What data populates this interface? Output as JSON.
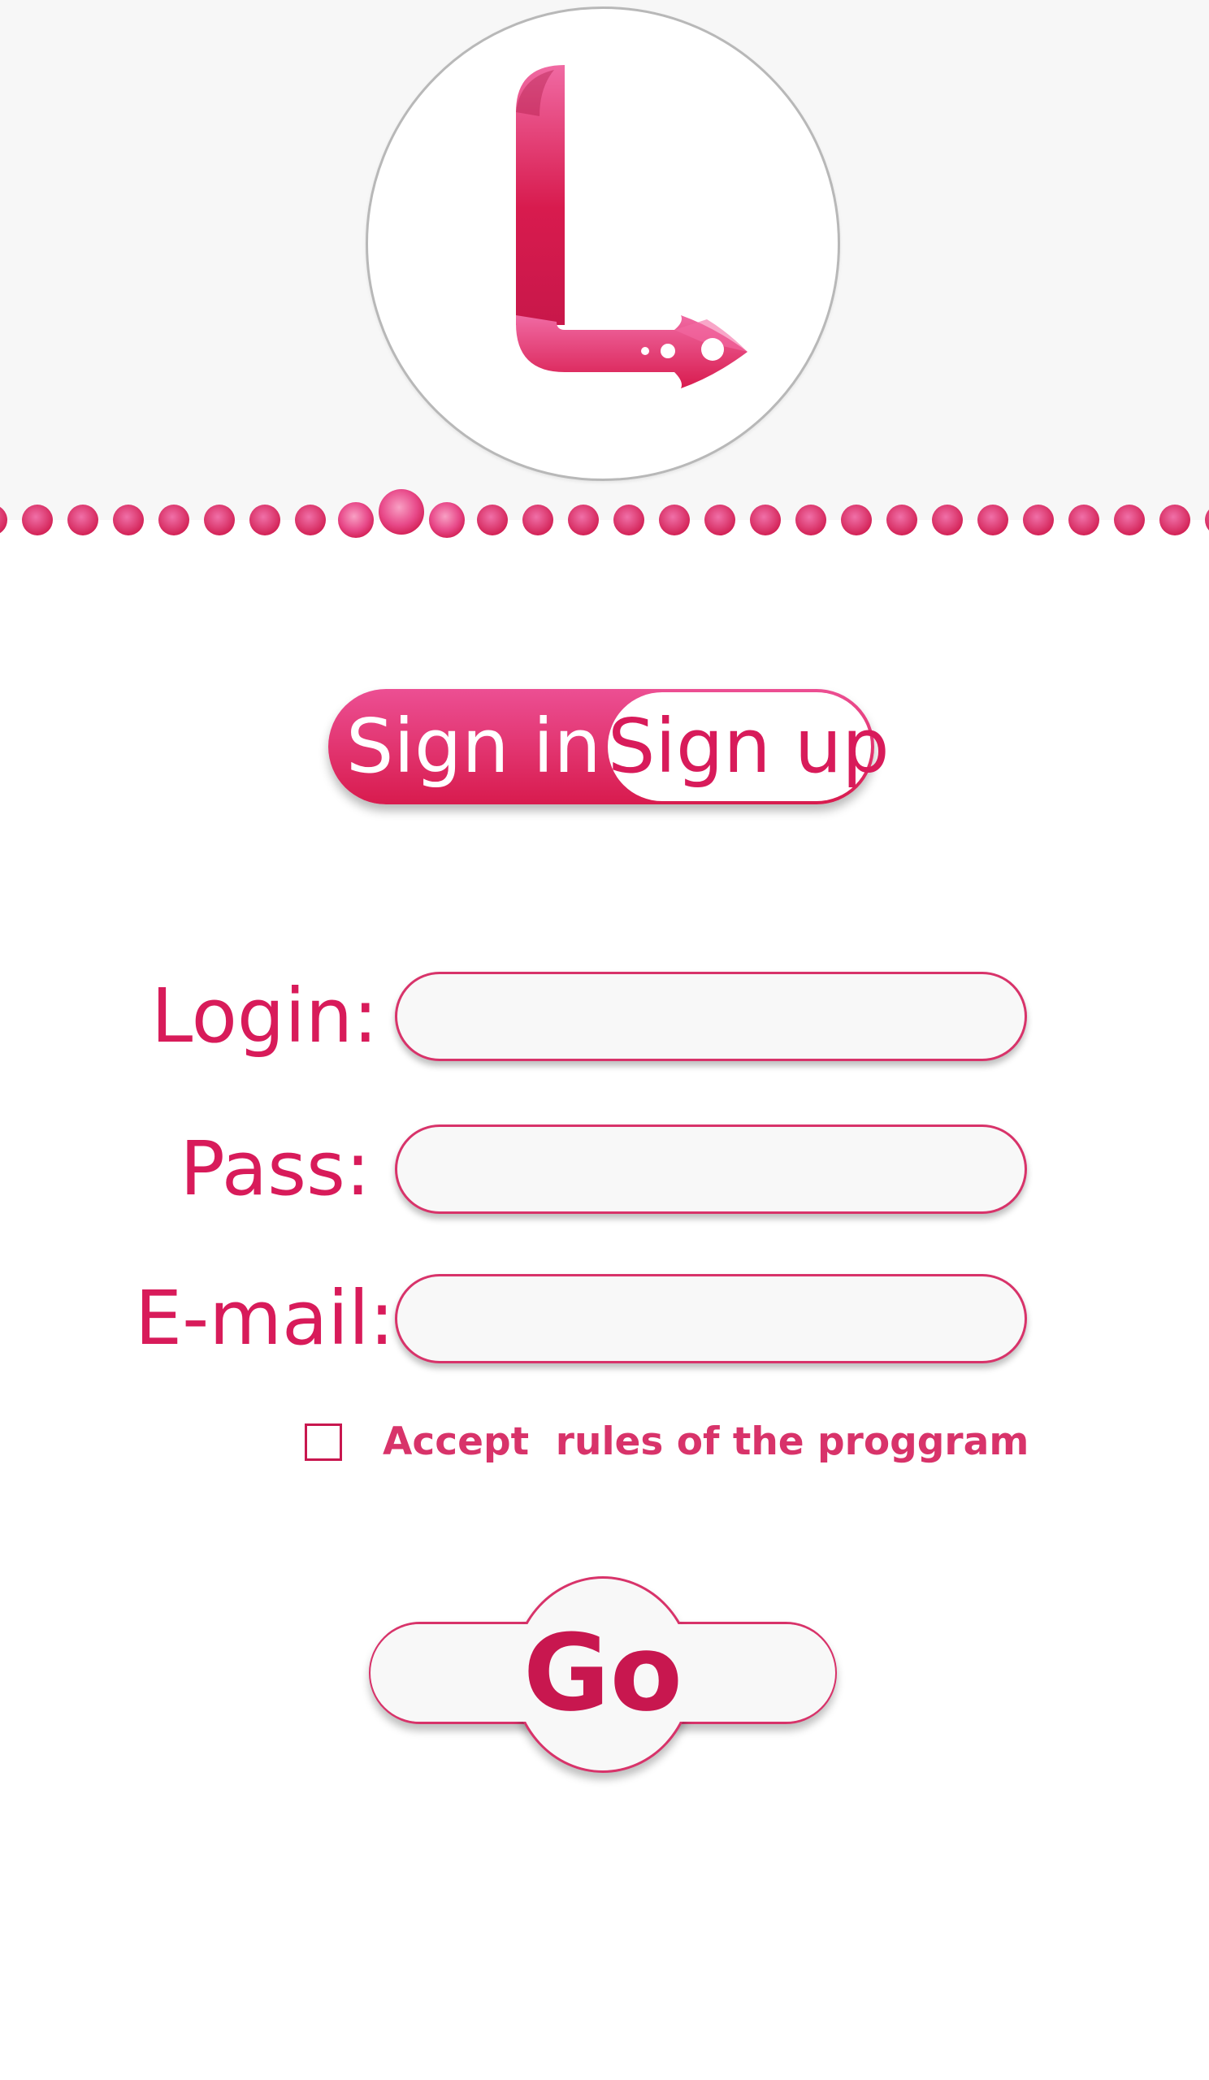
{
  "colors": {
    "accent": "#d81b5a",
    "accent_light": "#ec4f93",
    "header_bg": "#f7f7f7",
    "field_bg": "#f8f8f8"
  },
  "logo": {
    "letter_icon": "letter-l-rocket-icon"
  },
  "auth_toggle": {
    "sign_in_label": "Sign in",
    "sign_up_label": "Sign up",
    "selected": "Sign in"
  },
  "form": {
    "login_label": "Login:",
    "login_value": "",
    "pass_label": "Pass:",
    "pass_value": "",
    "email_label": "E-mail:",
    "email_value": "",
    "accept_checked": false,
    "accept_label": "Accept  rules of the proggram",
    "submit_label": "Go"
  }
}
